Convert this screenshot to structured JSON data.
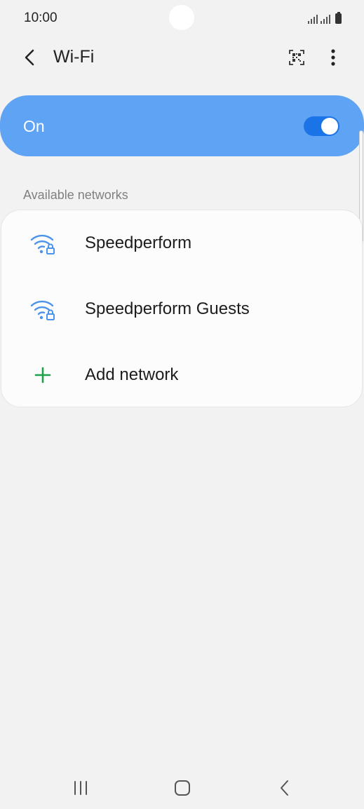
{
  "status_bar": {
    "time": "10:00",
    "icons": [
      "signal-icon",
      "signal-icon",
      "battery-icon"
    ]
  },
  "app_bar": {
    "title": "Wi-Fi",
    "back_icon": "chevron-left-icon",
    "qr_icon": "qr-code-scan-icon",
    "more_icon": "more-vertical-icon"
  },
  "wifi_toggle": {
    "label": "On",
    "state": true
  },
  "networks": {
    "header": "Available networks",
    "items": [
      {
        "name": "Speedperform",
        "icon": "wifi-secured-icon"
      },
      {
        "name": "Speedperform Guests",
        "icon": "wifi-secured-icon"
      }
    ],
    "add_network": {
      "label": "Add network",
      "icon": "plus-icon"
    }
  },
  "nav_bar": {
    "buttons": [
      "recents-icon",
      "home-icon",
      "back-icon"
    ]
  },
  "colors": {
    "background": "#f2f2f2",
    "toggle_card": "#5fa3f5",
    "switch_track": "#1a74e8",
    "wifi_icon": "#4b93ea",
    "add_icon": "#1fa14a"
  }
}
